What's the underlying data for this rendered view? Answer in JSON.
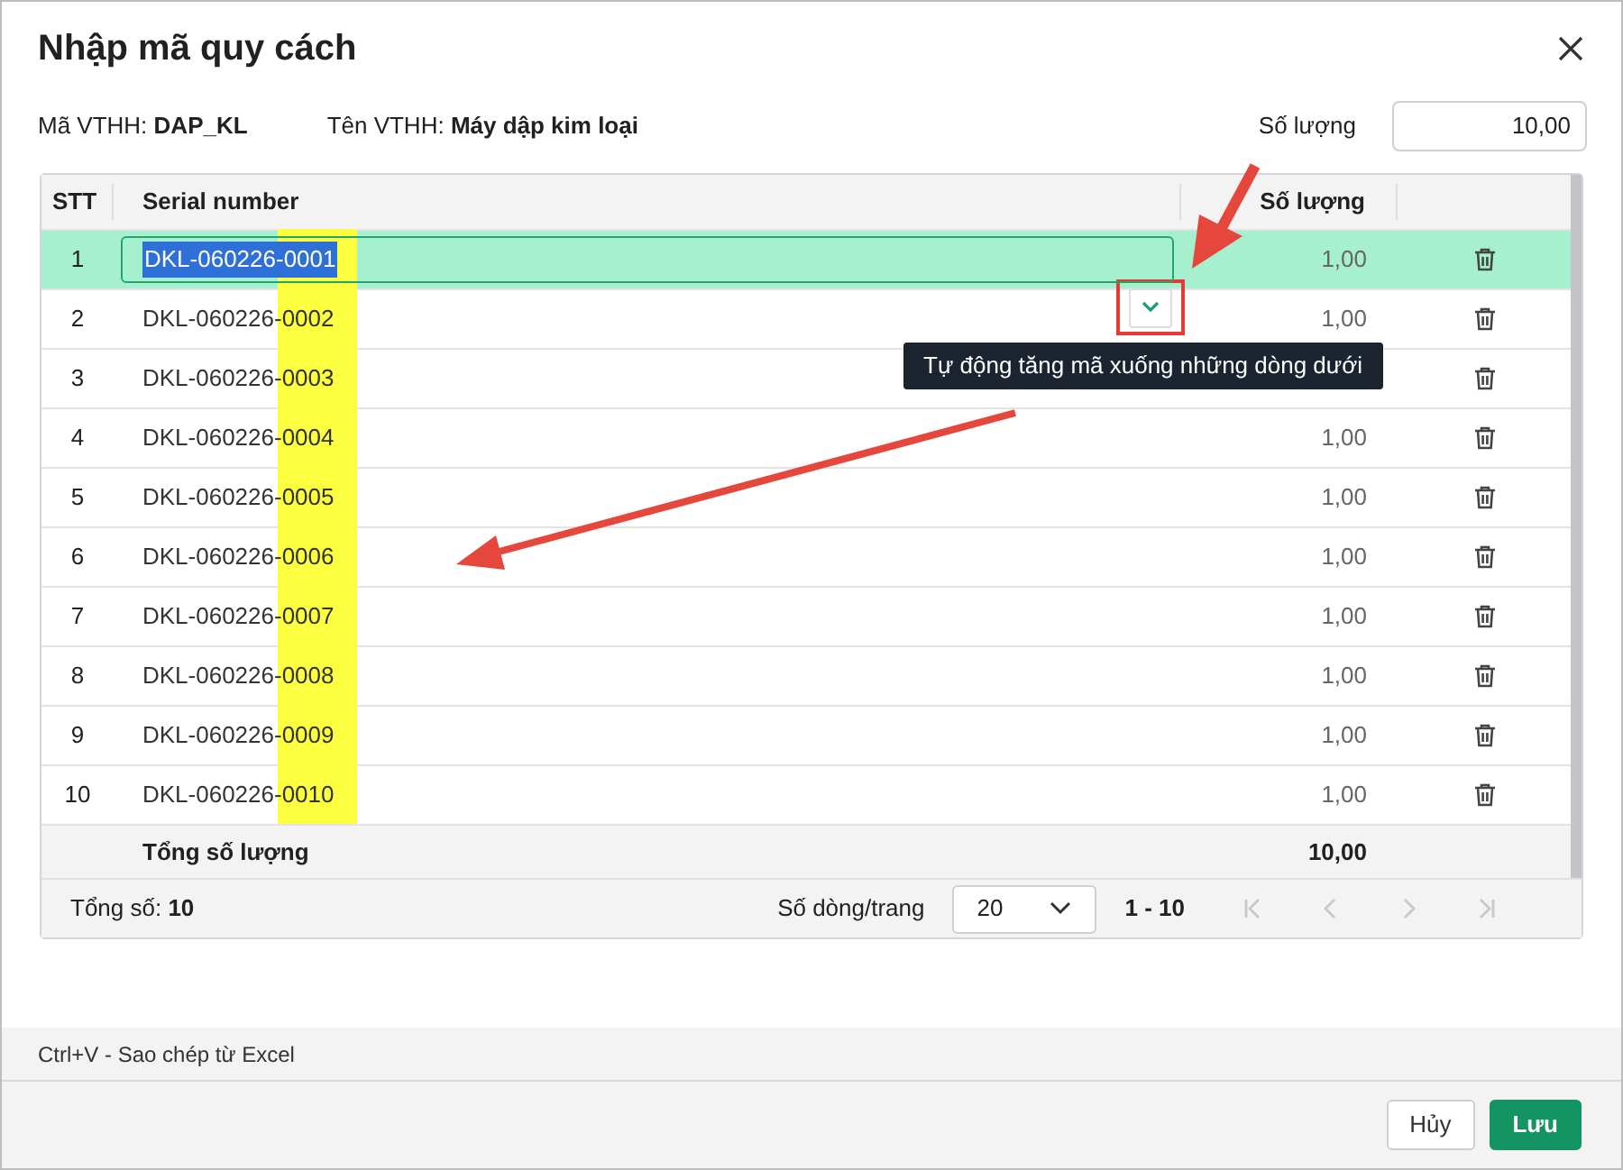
{
  "dialog": {
    "title": "Nhập mã quy cách"
  },
  "info": [
    {
      "label": "Mã VTHH:",
      "value": "DAP_KL"
    },
    {
      "label": "Tên VTHH:",
      "value": "Máy dập kim loại"
    }
  ],
  "quantity": {
    "label": "Số lượng",
    "value": "10,00"
  },
  "table": {
    "columns": [
      "STT",
      "Serial number",
      "Số lượng"
    ],
    "rows": [
      {
        "stt": "1",
        "serial": "DKL-060226-0001",
        "qty": "1,00",
        "selected": true
      },
      {
        "stt": "2",
        "serial": "DKL-060226-0002",
        "qty": "1,00",
        "selected": false
      },
      {
        "stt": "3",
        "serial": "DKL-060226-0003",
        "selected": false
      },
      {
        "stt": "4",
        "serial": "DKL-060226-0004",
        "qty": "1,00",
        "selected": false
      },
      {
        "stt": "5",
        "serial": "DKL-060226-0005",
        "qty": "1,00",
        "selected": false
      },
      {
        "stt": "6",
        "serial": "DKL-060226-0006",
        "qty": "1,00",
        "selected": false
      },
      {
        "stt": "7",
        "serial": "DKL-060226-0007",
        "qty": "1,00",
        "selected": false
      },
      {
        "stt": "8",
        "serial": "DKL-060226-0008",
        "qty": "1,00",
        "selected": false
      },
      {
        "stt": "9",
        "serial": "DKL-060226-0009",
        "qty": "1,00",
        "selected": false
      },
      {
        "stt": "10",
        "serial": "DKL-060226-0010",
        "qty": "1,00",
        "selected": false
      }
    ],
    "total": {
      "label": "Tổng số lượng",
      "value": "10,00"
    }
  },
  "pagination": {
    "total_label": "Tổng số:",
    "total_value": "10",
    "page_size_label": "Số dòng/trang",
    "page_size": "20",
    "range": "1 - 10"
  },
  "tooltip": "Tự động tăng mã xuống những dòng dưới",
  "hint": "Ctrl+V - Sao chép từ Excel",
  "buttons": [
    {
      "label": "Hủy",
      "kind": "secondary"
    },
    {
      "label": "Lưu",
      "kind": "primary"
    }
  ]
}
